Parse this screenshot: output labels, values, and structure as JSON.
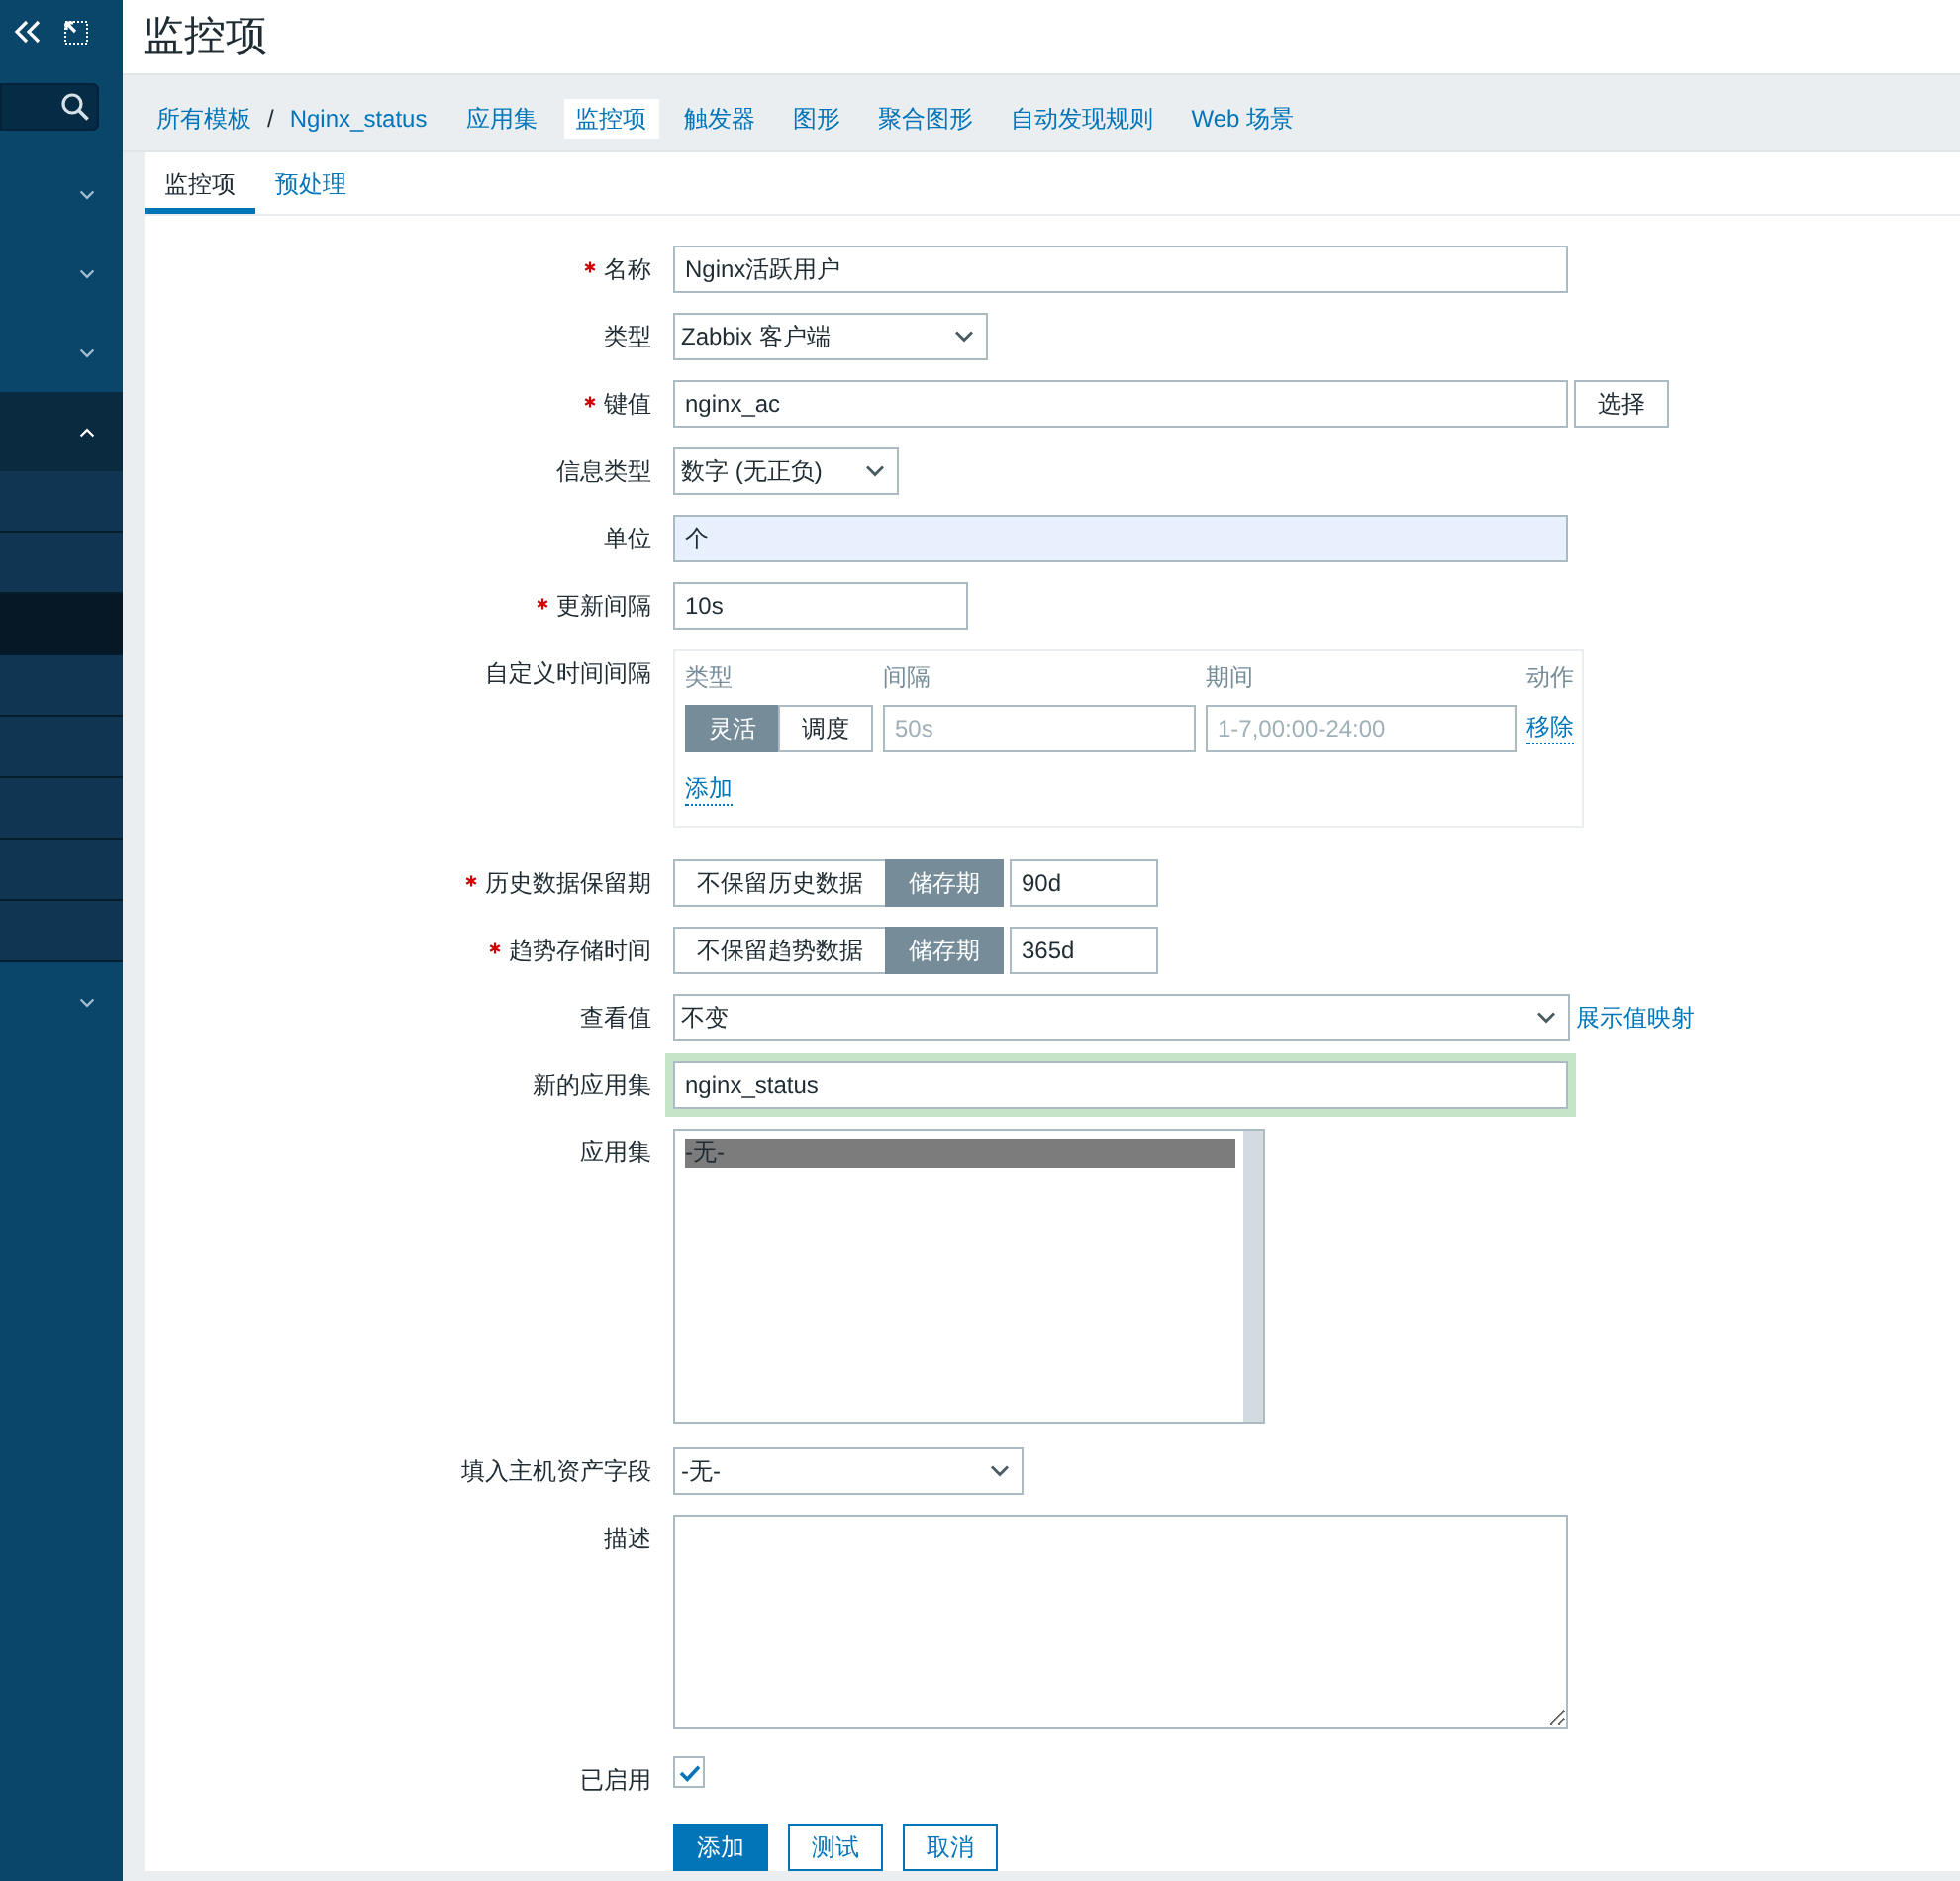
{
  "sidebar": {
    "sections": [
      {
        "expanded": false
      },
      {
        "expanded": false
      },
      {
        "expanded": false
      },
      {
        "expanded": true,
        "items": [
          {
            "selected": false
          },
          {
            "selected": false
          },
          {
            "selected": true
          },
          {
            "selected": false
          },
          {
            "selected": false
          },
          {
            "selected": false
          },
          {
            "selected": false
          },
          {
            "selected": false
          }
        ]
      },
      {
        "expanded": false
      }
    ]
  },
  "page_title": "监控项",
  "breadcrumb": {
    "items": [
      "所有模板",
      "Nginx_status"
    ],
    "separator": "/"
  },
  "nav_tabs": [
    {
      "label": "应用集",
      "selected": false
    },
    {
      "label": "监控项",
      "selected": true
    },
    {
      "label": "触发器",
      "selected": false
    },
    {
      "label": "图形",
      "selected": false
    },
    {
      "label": "聚合图形",
      "selected": false
    },
    {
      "label": "自动发现规则",
      "selected": false
    },
    {
      "label": "Web 场景",
      "selected": false
    }
  ],
  "form_tabs": [
    {
      "label": "监控项",
      "selected": true
    },
    {
      "label": "预处理",
      "selected": false
    }
  ],
  "form": {
    "name": {
      "label": "名称",
      "required": true,
      "value": "Nginx活跃用户"
    },
    "type": {
      "label": "类型",
      "required": false,
      "value": "Zabbix 客户端"
    },
    "key": {
      "label": "键值",
      "required": true,
      "value": "nginx_ac",
      "button": "选择"
    },
    "info_type": {
      "label": "信息类型",
      "required": false,
      "value": "数字 (无正负)"
    },
    "units": {
      "label": "单位",
      "required": false,
      "value": "个",
      "autofilled": true
    },
    "update_interval": {
      "label": "更新间隔",
      "required": true,
      "value": "10s"
    },
    "custom_intervals": {
      "label": "自定义时间间隔",
      "required": false,
      "columns": [
        "类型",
        "间隔",
        "期间",
        "动作"
      ],
      "rows": [
        {
          "modes": [
            {
              "label": "灵活",
              "selected": true
            },
            {
              "label": "调度",
              "selected": false
            }
          ],
          "interval": {
            "placeholder": "50s"
          },
          "period": {
            "placeholder": "1-7,00:00-24:00"
          },
          "action": "移除"
        }
      ],
      "add_link": "添加"
    },
    "history": {
      "label": "历史数据保留期",
      "required": true,
      "options": [
        {
          "label": "不保留历史数据",
          "selected": false
        },
        {
          "label": "储存期",
          "selected": true
        }
      ],
      "value": "90d"
    },
    "trends": {
      "label": "趋势存储时间",
      "required": true,
      "options": [
        {
          "label": "不保留趋势数据",
          "selected": false
        },
        {
          "label": "储存期",
          "selected": true
        }
      ],
      "value": "365d"
    },
    "show_value": {
      "label": "查看值",
      "required": false,
      "value": "不变",
      "link": "展示值映射"
    },
    "new_application": {
      "label": "新的应用集",
      "required": false,
      "value": "nginx_status",
      "focused": true
    },
    "applications": {
      "label": "应用集",
      "required": false,
      "options": [
        {
          "label": "-无-",
          "selected": true
        }
      ]
    },
    "inventory_field": {
      "label": "填入主机资产字段",
      "required": false,
      "value": "-无-"
    },
    "description": {
      "label": "描述",
      "required": false
    },
    "enabled": {
      "label": "已启用",
      "required": false,
      "checked": true
    }
  },
  "buttons": [
    {
      "label": "添加",
      "kind": "primary"
    },
    {
      "label": "测试",
      "kind": "secondary"
    },
    {
      "label": "取消",
      "kind": "secondary"
    }
  ]
}
